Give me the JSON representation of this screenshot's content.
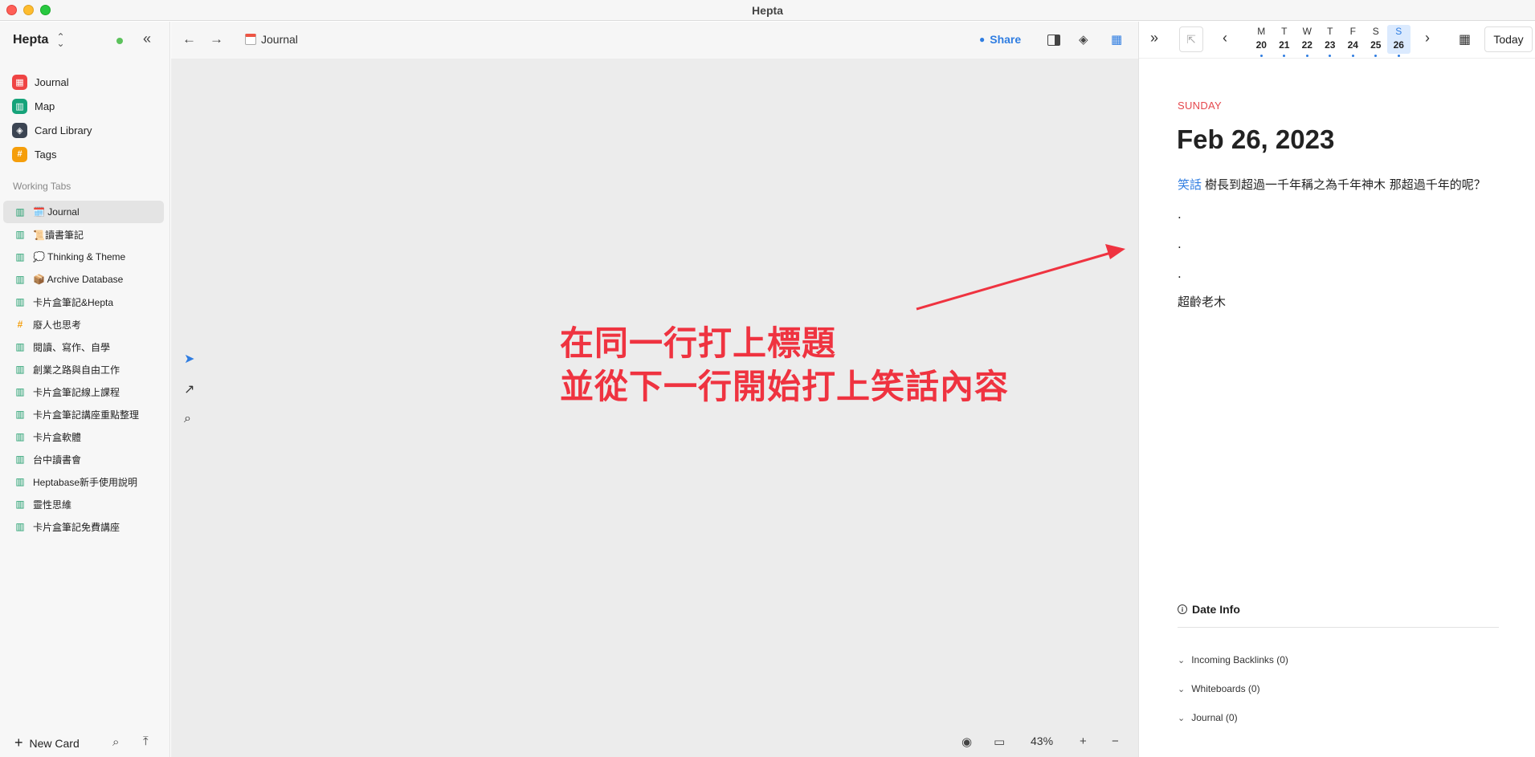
{
  "window": {
    "title": "Hepta"
  },
  "sidebar": {
    "workspace": "Hepta",
    "nav": [
      {
        "label": "Journal",
        "icon": "calendar-icon"
      },
      {
        "label": "Map",
        "icon": "map-icon"
      },
      {
        "label": "Card Library",
        "icon": "layers-icon"
      },
      {
        "label": "Tags",
        "icon": "hash-icon"
      }
    ],
    "working_tabs_label": "Working Tabs",
    "tabs": [
      {
        "label": "🗓️ Journal",
        "icon": "map-icon",
        "active": true
      },
      {
        "label": "📜讀書筆記",
        "icon": "map-icon"
      },
      {
        "label": "💭 Thinking & Theme",
        "icon": "map-icon"
      },
      {
        "label": "📦 Archive Database",
        "icon": "map-icon"
      },
      {
        "label": "卡片盒筆記&Hepta",
        "icon": "map-icon"
      },
      {
        "label": "廢人也思考",
        "icon": "hash-icon"
      },
      {
        "label": "閱讀、寫作、自學",
        "icon": "map-icon"
      },
      {
        "label": "創業之路與自由工作",
        "icon": "map-icon"
      },
      {
        "label": "卡片盒筆記線上課程",
        "icon": "map-icon"
      },
      {
        "label": "卡片盒筆記講座重點整理",
        "icon": "map-icon"
      },
      {
        "label": "卡片盒軟體",
        "icon": "map-icon"
      },
      {
        "label": "台中讀書會",
        "icon": "map-icon"
      },
      {
        "label": "Heptabase新手使用說明",
        "icon": "map-icon"
      },
      {
        "label": "靈性思維",
        "icon": "map-icon"
      },
      {
        "label": "卡片盒筆記免費講座",
        "icon": "map-icon"
      }
    ],
    "new_card_label": "New Card"
  },
  "main": {
    "title": "Journal",
    "share_label": "Share",
    "zoom": "43%",
    "annotation_line1": "在同一行打上標題",
    "annotation_line2": "並從下一行開始打上笑話內容"
  },
  "right_panel": {
    "week": [
      {
        "letter": "M",
        "num": "20"
      },
      {
        "letter": "T",
        "num": "21"
      },
      {
        "letter": "W",
        "num": "22"
      },
      {
        "letter": "T",
        "num": "23"
      },
      {
        "letter": "F",
        "num": "24"
      },
      {
        "letter": "S",
        "num": "25"
      },
      {
        "letter": "S",
        "num": "26",
        "selected": true
      }
    ],
    "today_label": "Today",
    "weekday": "SUNDAY",
    "date_title": "Feb 26, 2023",
    "tag_word": "笑話",
    "body_text": "樹長到超過一千年稱之為千年神木 那超過千年的呢？",
    "dots": [
      ".",
      ".",
      "."
    ],
    "answer": "超齡老木",
    "date_info_label": "Date Info",
    "sections": [
      {
        "label": "Incoming Backlinks (0)"
      },
      {
        "label": "Whiteboards (0)"
      },
      {
        "label": "Journal (0)"
      }
    ]
  },
  "colors": {
    "accent": "#2f7de1",
    "annotation": "#ef3340",
    "weekday": "#e5484d"
  }
}
